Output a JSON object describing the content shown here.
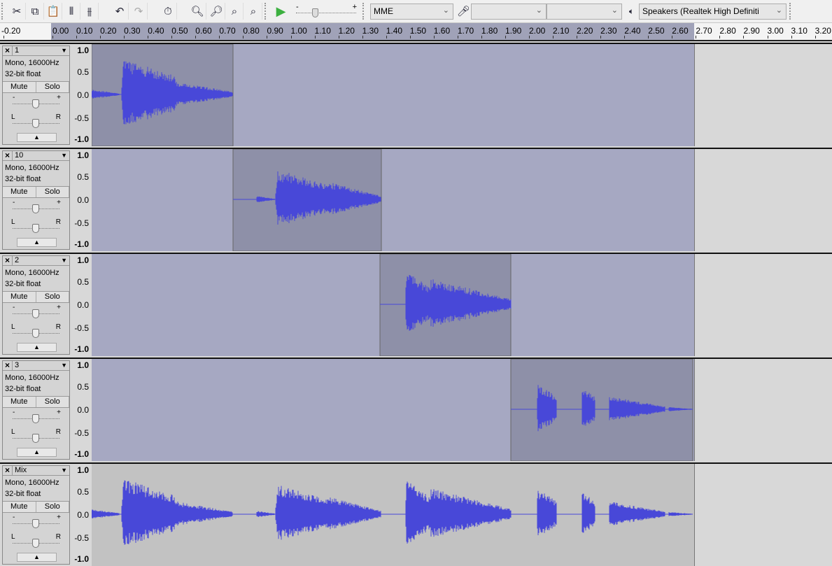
{
  "toolbar": {
    "tools": [
      "trim-audio-icon",
      "silence-audio-icon",
      "paste-icon",
      "trim-outside-icon",
      "silence-selection-icon",
      "undo-icon",
      "redo-icon",
      "timer-record-icon",
      "zoom-in-icon",
      "zoom-out-icon",
      "fit-selection-icon",
      "fit-project-icon",
      "play-icon"
    ],
    "host": "MME",
    "recording_device": "",
    "recording_channels": "",
    "playback_device": "Speakers (Realtek High Definiti",
    "playback_speed_minus": "-",
    "playback_speed_plus": "+"
  },
  "ruler": {
    "labels": [
      "-0.20",
      "0.00",
      "0.10",
      "0.20",
      "0.30",
      "0.40",
      "0.50",
      "0.60",
      "0.70",
      "0.80",
      "0.90",
      "1.00",
      "1.10",
      "1.20",
      "1.30",
      "1.40",
      "1.50",
      "1.60",
      "1.70",
      "1.80",
      "1.90",
      "2.00",
      "2.10",
      "2.20",
      "2.30",
      "2.40",
      "2.50",
      "2.60",
      "2.70",
      "2.80",
      "2.90",
      "3.00",
      "3.10",
      "3.20"
    ]
  },
  "vruler": [
    "1.0",
    "0.5",
    "0.0",
    "-0.5",
    "-1.0"
  ],
  "tracks": [
    {
      "name": "1",
      "info1": "Mono, 16000Hz",
      "info2": "32-bit float",
      "mute": "Mute",
      "solo": "Solo",
      "gain_min": "-",
      "gain_max": "+",
      "pan_left": "L",
      "pan_right": "R"
    },
    {
      "name": "10",
      "info1": "Mono, 16000Hz",
      "info2": "32-bit float",
      "mute": "Mute",
      "solo": "Solo",
      "gain_min": "-",
      "gain_max": "+",
      "pan_left": "L",
      "pan_right": "R"
    },
    {
      "name": "2",
      "info1": "Mono, 16000Hz",
      "info2": "32-bit float",
      "mute": "Mute",
      "solo": "Solo",
      "gain_min": "-",
      "gain_max": "+",
      "pan_left": "L",
      "pan_right": "R"
    },
    {
      "name": "3",
      "info1": "Mono, 16000Hz",
      "info2": "32-bit float",
      "mute": "Mute",
      "solo": "Solo",
      "gain_min": "-",
      "gain_max": "+",
      "pan_left": "L",
      "pan_right": "R"
    },
    {
      "name": "Mix",
      "info1": "Mono, 16000Hz",
      "info2": "32-bit float",
      "mute": "Mute",
      "solo": "Solo",
      "gain_min": "-",
      "gain_max": "+",
      "pan_left": "L",
      "pan_right": "R"
    }
  ],
  "colors": {
    "track_bg": "#a6a8c2",
    "clip_bg": "#8e90a8",
    "mix_bg": "#c2c2c2",
    "wave": "#4848d8"
  }
}
